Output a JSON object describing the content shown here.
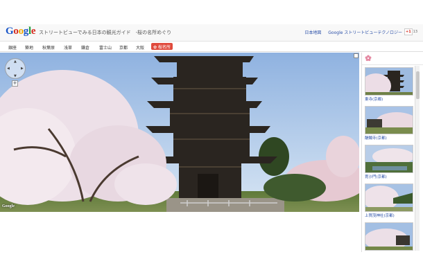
{
  "header": {
    "site_title": "ストリートビューでみる日本の観光ガイド　-桜の名所めぐり",
    "links": [
      "日本地図",
      "Google ストリートビューテクノロジー"
    ],
    "gplus_label": "+1",
    "gplus_count": "13"
  },
  "nav": {
    "tabs": [
      "銀座",
      "築地",
      "秋葉原",
      "浅草",
      "鎌倉",
      "富士山",
      "京都",
      "大阪"
    ],
    "active_tab": "桜名所"
  },
  "sidebar": {
    "thumbnails": [
      {
        "caption": "東寺(京都)"
      },
      {
        "caption": "醍醐寺(京都)"
      },
      {
        "caption": "毘沙門(京都)"
      },
      {
        "caption": "上賀茂神社(京都)"
      },
      {
        "caption": ""
      }
    ]
  },
  "streetview": {
    "zoom_in_label": "+",
    "watermark": "Google"
  }
}
